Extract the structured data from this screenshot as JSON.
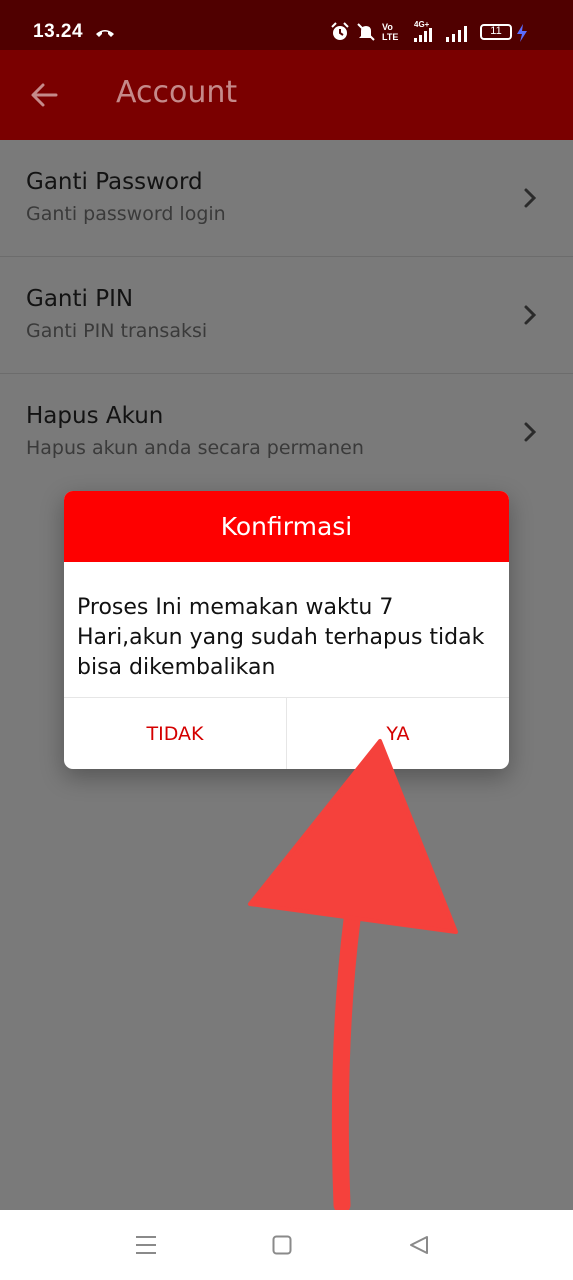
{
  "status_bar": {
    "time": "13.24",
    "volte_label": "Vo LTE",
    "network_label": "4G+",
    "battery": "11",
    "icons": [
      "missed-call-icon",
      "alarm-icon",
      "mute-icon",
      "volte-icon",
      "signal-4g-icon",
      "signal-icon",
      "battery-icon",
      "charging-icon"
    ]
  },
  "app_bar": {
    "title": "Account",
    "back_icon": "arrow-left-icon"
  },
  "settings": [
    {
      "title": "Ganti Password",
      "subtitle": "Ganti password login"
    },
    {
      "title": "Ganti PIN",
      "subtitle": "Ganti PIN transaksi"
    },
    {
      "title": "Hapus Akun",
      "subtitle": "Hapus akun anda secara permanen"
    }
  ],
  "dialog": {
    "title": "Konfirmasi",
    "message": "Proses Ini memakan waktu 7 Hari,akun yang sudah terhapus tidak bisa dikembalikan",
    "cancel_label": "TIDAK",
    "confirm_label": "YA"
  },
  "colors": {
    "status_bar": "#500000",
    "app_bar": "#7a0000",
    "dialog_header": "#fe0000",
    "dialog_button_text": "#d40000",
    "annotation_arrow": "#f5413c",
    "overlay_background": "#7a7a7a"
  },
  "nav_bar": {
    "icons": [
      "menu-icon",
      "home-icon",
      "back-triangle-icon"
    ]
  }
}
